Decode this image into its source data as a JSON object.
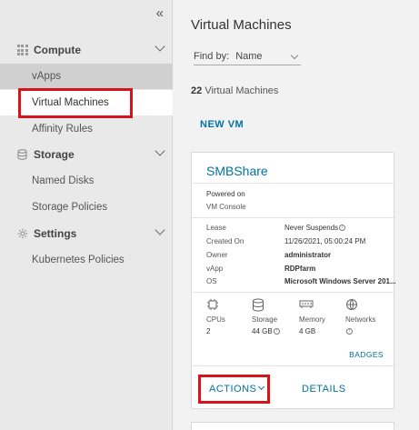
{
  "sidebar": {
    "collapse_glyph": "«",
    "groups": [
      {
        "label": "Compute",
        "icon": "grid-dots-icon",
        "items": [
          {
            "label": "vApps"
          },
          {
            "label": "Virtual Machines"
          },
          {
            "label": "Affinity Rules"
          }
        ]
      },
      {
        "label": "Storage",
        "icon": "database-icon",
        "items": [
          {
            "label": "Named Disks"
          },
          {
            "label": "Storage Policies"
          }
        ]
      },
      {
        "label": "Settings",
        "icon": "gear-icon",
        "items": [
          {
            "label": "Kubernetes Policies"
          }
        ]
      }
    ]
  },
  "main": {
    "title": "Virtual Machines",
    "find_by_label": "Find by:",
    "find_by_value": "Name",
    "count_number": "22",
    "count_text": "Virtual Machines",
    "new_vm_label": "NEW VM"
  },
  "card": {
    "name": "SMBShare",
    "power_state": "Powered on",
    "console_link": "VM Console",
    "fields": [
      {
        "key": "Lease",
        "value": "Never Suspends"
      },
      {
        "key": "Created On",
        "value": "11/26/2021, 05:00:24 PM"
      },
      {
        "key": "Owner",
        "value": "administrator"
      },
      {
        "key": "vApp",
        "value": "RDPfarm"
      },
      {
        "key": "OS",
        "value": "Microsoft Windows Server 201..."
      }
    ],
    "metrics": [
      {
        "label": "CPUs",
        "value": "2",
        "icon": "cpu-icon"
      },
      {
        "label": "Storage",
        "value": "44 GB",
        "icon": "storage-icon"
      },
      {
        "label": "Memory",
        "value": "4 GB",
        "icon": "memory-icon"
      },
      {
        "label": "Networks",
        "value": "",
        "icon": "network-icon"
      }
    ],
    "badges_label": "BADGES",
    "actions_label": "ACTIONS",
    "details_label": "DETAILS"
  },
  "colors": {
    "link": "#0072a3",
    "highlight": "#d7141a"
  }
}
